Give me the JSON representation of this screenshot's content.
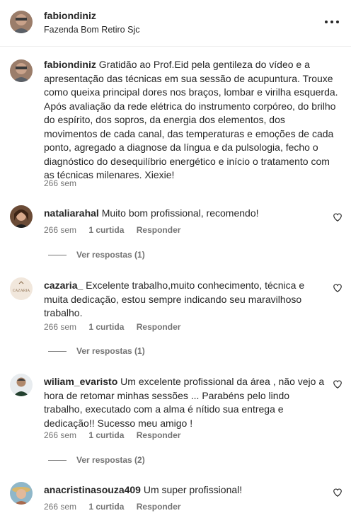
{
  "header": {
    "username": "fabiondiniz",
    "location": "Fazenda Bom Retiro Sjc",
    "more_icon": "more-horizontal-icon"
  },
  "caption": {
    "username": "fabiondiniz",
    "text": "Gratidão ao Prof.Eid pela gentileza do vídeo e a apresentação das técnicas em sua sessão de acupuntura. Trouxe como queixa principal dores nos braços, lombar e virilha esquerda. Após avaliação da rede elétrica do instrumento corpóreo, do brilho do espírito, dos sopros, da energia dos elementos, dos movimentos de cada canal, das temperaturas e emoções de cada ponto, agregado a diagnose da língua e da pulsologia, fecho o diagnóstico do desequilíbrio energético e início o tratamento com as técnicas milenares. Xiexie!",
    "time": "266 sem"
  },
  "comments": [
    {
      "username": "nataliarahal",
      "text": "Muito bom profissional, recomendo!",
      "time": "266 sem",
      "likes": "1 curtida",
      "reply_label": "Responder",
      "view_replies": "Ver respostas (1)"
    },
    {
      "username": "cazaria_",
      "avatar_text": "CAZARIA",
      "text": "Excelente trabalho,muito conhecimento, técnica e muita dedicação, estou sempre indicando seu maravilhoso trabalho.",
      "time": "266 sem",
      "likes": "1 curtida",
      "reply_label": "Responder",
      "view_replies": "Ver respostas (1)"
    },
    {
      "username": "wiliam_evaristo",
      "text": "Um excelente profissional da área , não vejo a hora de retomar minhas sessões ... Parabéns pelo lindo trabalho, executado com a alma é nítido sua entrega e dedicação!! Sucesso meu amigo !",
      "time": "266 sem",
      "likes": "1 curtida",
      "reply_label": "Responder",
      "view_replies": "Ver respostas (2)"
    },
    {
      "username": "anacristinasouza409",
      "text": "Um super profissional!",
      "time": "266 sem",
      "likes": "1 curtida",
      "reply_label": "Responder"
    }
  ],
  "colors": {
    "text": "#262626",
    "secondary": "#737373",
    "divider": "#efefef"
  }
}
